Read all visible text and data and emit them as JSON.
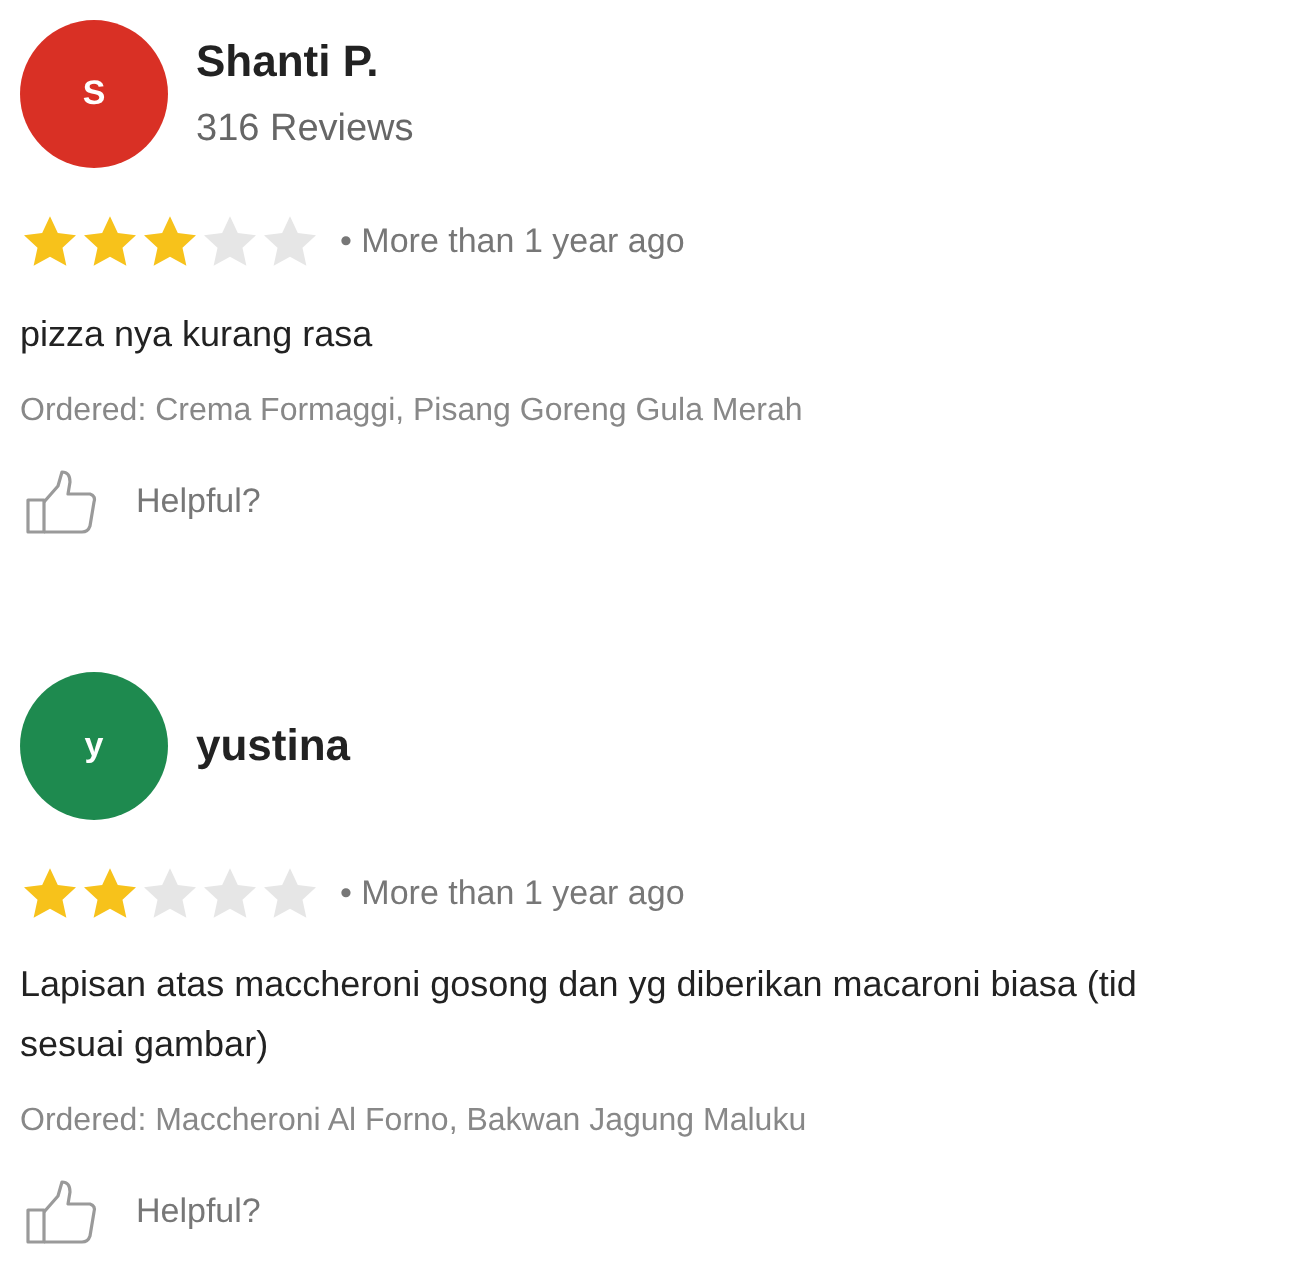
{
  "reviews": [
    {
      "avatar_letter": "S",
      "color": "#d93025",
      "name": "Shanti P.",
      "review_count": "316 Reviews",
      "stars": 3,
      "time": "• More than 1 year ago",
      "text_lines": [
        "pizza nya kurang rasa"
      ],
      "ordered": "Ordered: Crema Formaggi, Pisang Goreng Gula Merah",
      "helpful": "Helpful?"
    },
    {
      "avatar_letter": "y",
      "color": "#1e8a4f",
      "name": "yustina",
      "stars": 2,
      "time": "• More than 1 year ago",
      "text_lines": [
        "Lapisan atas maccheroni gosong dan yg diberikan macaroni biasa (tid",
        "sesuai gambar)"
      ],
      "ordered": "Ordered: Maccheroni Al Forno, Bakwan Jagung Maluku",
      "helpful": "Helpful?"
    }
  ]
}
